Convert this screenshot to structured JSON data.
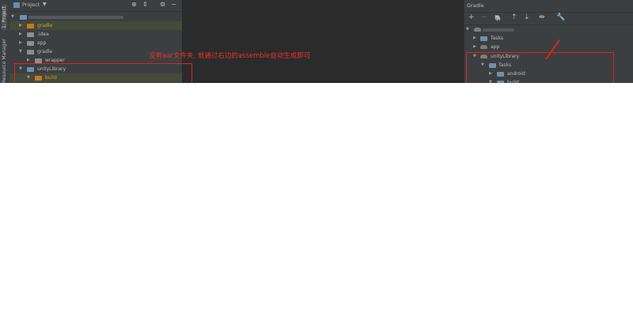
{
  "left_strip": {
    "project_tab": "1: Project",
    "resource_tab": "Resource Manager"
  },
  "project_panel": {
    "title": "Project",
    "dropdown": "▼",
    "icons": [
      "target-icon",
      "collapse-icon",
      "gear-icon",
      "minimize-icon"
    ],
    "items": [
      {
        "label": "gradle",
        "kind": "folder-orange",
        "arrow": "▶"
      },
      {
        "label": ".idea",
        "kind": "folder",
        "arrow": "▶"
      },
      {
        "label": "app",
        "kind": "folder",
        "arrow": "▶"
      },
      {
        "label": "gradle",
        "kind": "folder",
        "arrow": "▼"
      },
      {
        "label": "wrapper",
        "kind": "folder",
        "arrow": "▶"
      },
      {
        "label": "unityLibrary",
        "kind": "module",
        "arrow": "▼"
      },
      {
        "label": "build",
        "kind": "folder-orange",
        "arrow": "▼"
      }
    ]
  },
  "annotation": {
    "text": "没有aar文件夹, 就通过右边的assemble自动生成即可",
    "color": "#e8322b"
  },
  "gradle_panel": {
    "title": "Gradle",
    "toolbar": [
      "+",
      "−",
      "elephant-icon",
      "expand-icon",
      "collapse-icon",
      "link-icon",
      "wrench-icon"
    ],
    "items": [
      {
        "label": "Tasks",
        "arrow": "▶"
      },
      {
        "label": "app",
        "arrow": "▶"
      },
      {
        "label": "unityLibrary",
        "arrow": "▼"
      },
      {
        "label": "Tasks",
        "arrow": "▼"
      },
      {
        "label": "android",
        "arrow": "▶"
      },
      {
        "label": "build",
        "arrow": "▼"
      }
    ]
  }
}
